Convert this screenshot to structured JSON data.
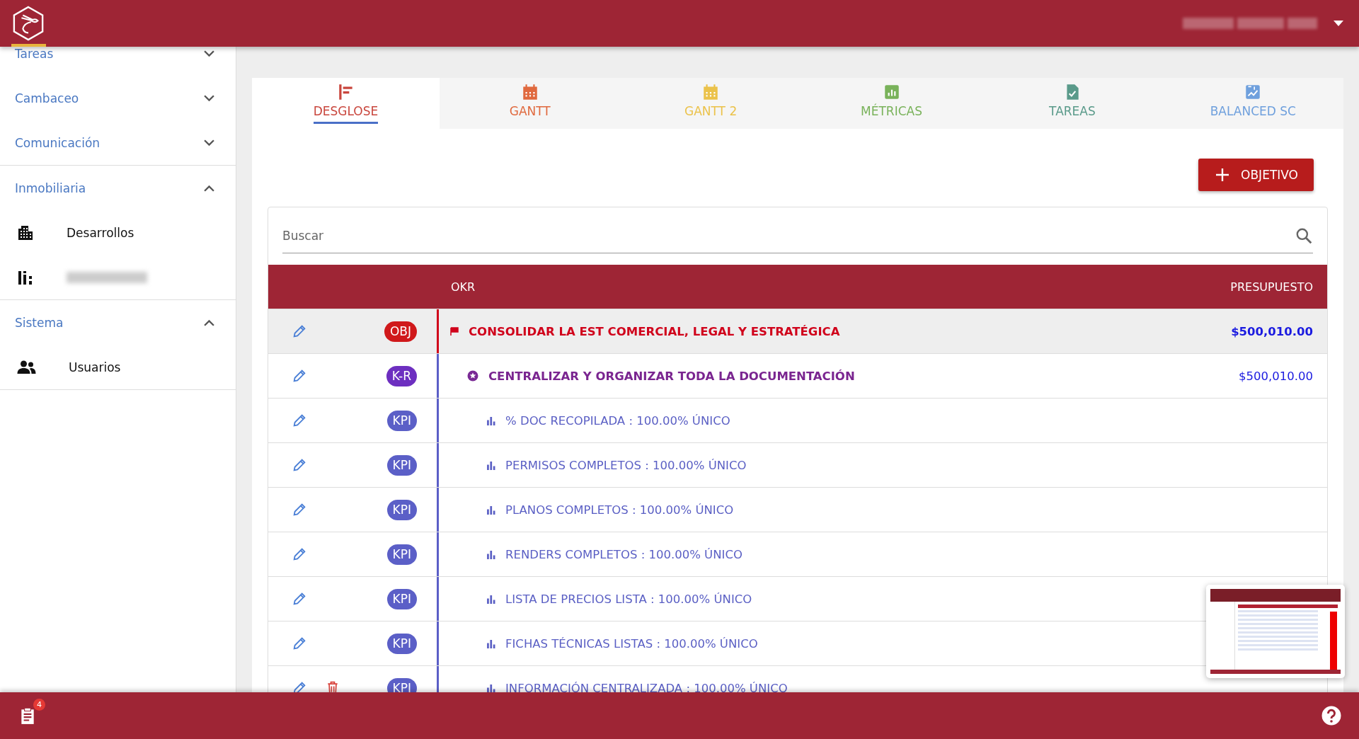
{
  "sidebar": {
    "sections": [
      {
        "label": "Tareas",
        "expanded": false
      },
      {
        "label": "Cambaceo",
        "expanded": false
      },
      {
        "label": "Comunicación",
        "expanded": false
      },
      {
        "label": "Inmobiliaria",
        "expanded": true,
        "children": [
          {
            "label": "Desarrollos",
            "redacted": false
          },
          {
            "redacted": true
          }
        ]
      },
      {
        "label": "Sistema",
        "expanded": true,
        "children": [
          {
            "label": "Usuarios",
            "redacted": false
          }
        ]
      }
    ]
  },
  "tabs": [
    {
      "label": "DESGLOSE",
      "selected": true,
      "color": "#c9463d"
    },
    {
      "label": "GANTT",
      "selected": false,
      "color": "#e0693e"
    },
    {
      "label": "GANTT 2",
      "selected": false,
      "color": "#ebc24a"
    },
    {
      "label": "MÉTRICAS",
      "selected": false,
      "color": "#79b25a"
    },
    {
      "label": "TAREAS",
      "selected": false,
      "color": "#5a9a8a"
    },
    {
      "label": "BALANCED SC",
      "selected": false,
      "color": "#6fa0dd"
    }
  ],
  "add_button": {
    "label": "OBJETIVO"
  },
  "search": {
    "placeholder": "Buscar"
  },
  "table": {
    "columns": [
      "OKR",
      "PRESUPUESTO"
    ],
    "rows": [
      {
        "kind": "obj",
        "tag": "OBJ",
        "text": "CONSOLIDAR LA EST COMERCIAL, LEGAL Y ESTRATÉGICA",
        "budget": "$500,010.00",
        "deletable": false
      },
      {
        "kind": "kr",
        "tag": "K-R",
        "text": "CENTRALIZAR Y ORGANIZAR TODA LA DOCUMENTACIÓN",
        "budget": "$500,010.00",
        "deletable": false
      },
      {
        "kind": "kpi",
        "tag": "KPI",
        "text": "% DOC RECOPILADA : 100.00% ÚNICO",
        "deletable": false
      },
      {
        "kind": "kpi",
        "tag": "KPI",
        "text": "PERMISOS COMPLETOS : 100.00% ÚNICO",
        "deletable": false
      },
      {
        "kind": "kpi",
        "tag": "KPI",
        "text": "PLANOS COMPLETOS : 100.00% ÚNICO",
        "deletable": false
      },
      {
        "kind": "kpi",
        "tag": "KPI",
        "text": "RENDERS COMPLETOS : 100.00% ÚNICO",
        "deletable": false
      },
      {
        "kind": "kpi",
        "tag": "KPI",
        "text": "LISTA DE PRECIOS LISTA : 100.00% ÚNICO",
        "deletable": false
      },
      {
        "kind": "kpi",
        "tag": "KPI",
        "text": "FICHAS TÉCNICAS LISTAS : 100.00% ÚNICO",
        "deletable": false
      },
      {
        "kind": "kpi",
        "tag": "KPI",
        "text": "INFORMACIÓN CENTRALIZADA : 100.00% ÚNICO",
        "deletable": true
      }
    ]
  },
  "footer": {
    "notification_count": "4"
  }
}
